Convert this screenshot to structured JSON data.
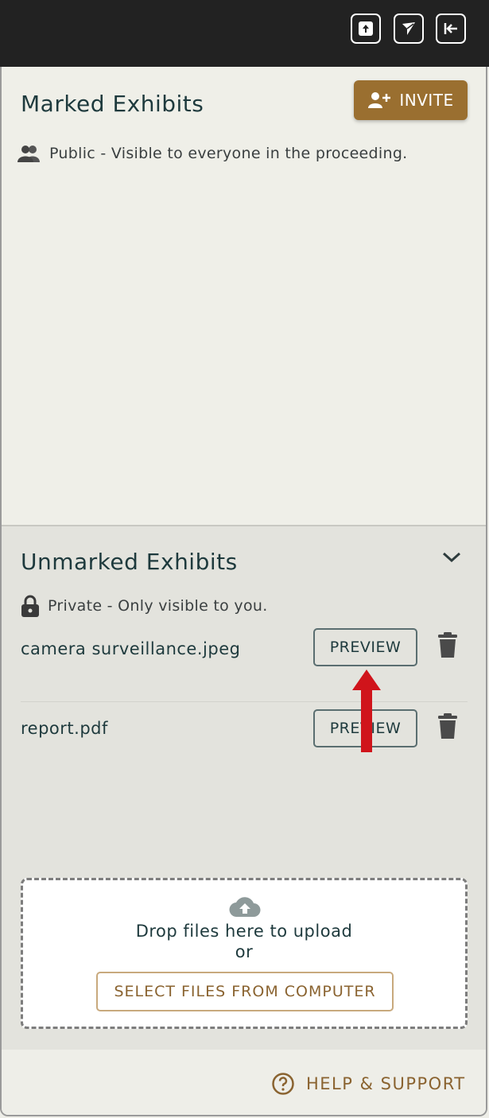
{
  "toolbar": {
    "icons": [
      "upload-icon",
      "send-icon",
      "collapse-panel-icon"
    ]
  },
  "marked": {
    "title": "Marked Exhibits",
    "invite_label": "INVITE",
    "visibility_text": "Public - Visible to everyone in the proceeding."
  },
  "unmarked": {
    "title": "Unmarked Exhibits",
    "visibility_text": "Private - Only visible to you.",
    "files": [
      {
        "name": "camera surveillance.jpeg",
        "action": "PREVIEW"
      },
      {
        "name": "report.pdf",
        "action": "PREVIEW"
      }
    ]
  },
  "upload": {
    "drop_text": "Drop files here to upload",
    "or_text": "or",
    "select_label": "SELECT FILES FROM COMPUTER"
  },
  "footer": {
    "help_label": "HELP & SUPPORT"
  },
  "colors": {
    "accent": "#9a6f30",
    "topbar": "#222222",
    "annotation_arrow": "#d0141b"
  }
}
